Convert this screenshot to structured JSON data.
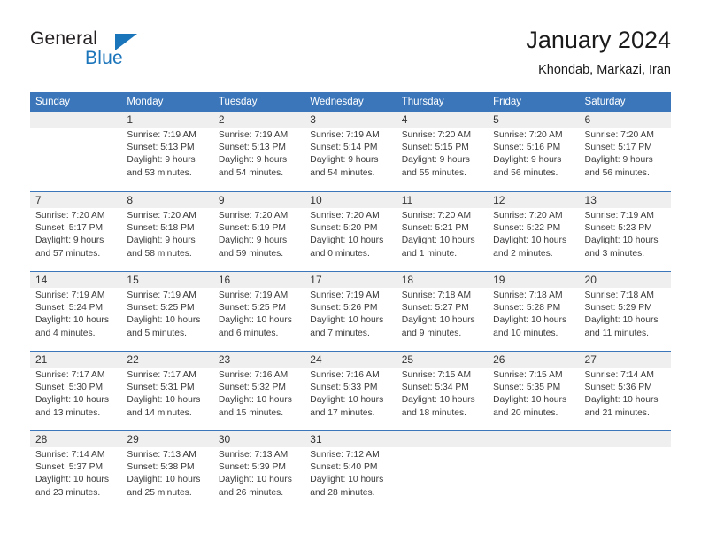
{
  "brand": {
    "name_part1": "General",
    "name_part2": "Blue",
    "accent_color": "#1b75bb",
    "triangle_icon": "triangle-icon"
  },
  "header": {
    "title": "January 2024",
    "subtitle": "Khondab, Markazi, Iran"
  },
  "calendar": {
    "header_bg": "#3b76ba",
    "daynum_band_bg": "#efefef",
    "weekday_headers": [
      "Sunday",
      "Monday",
      "Tuesday",
      "Wednesday",
      "Thursday",
      "Friday",
      "Saturday"
    ],
    "weeks": [
      [
        {
          "day": "",
          "info": ""
        },
        {
          "day": "1",
          "info": "Sunrise: 7:19 AM\nSunset: 5:13 PM\nDaylight: 9 hours\nand 53 minutes."
        },
        {
          "day": "2",
          "info": "Sunrise: 7:19 AM\nSunset: 5:13 PM\nDaylight: 9 hours\nand 54 minutes."
        },
        {
          "day": "3",
          "info": "Sunrise: 7:19 AM\nSunset: 5:14 PM\nDaylight: 9 hours\nand 54 minutes."
        },
        {
          "day": "4",
          "info": "Sunrise: 7:20 AM\nSunset: 5:15 PM\nDaylight: 9 hours\nand 55 minutes."
        },
        {
          "day": "5",
          "info": "Sunrise: 7:20 AM\nSunset: 5:16 PM\nDaylight: 9 hours\nand 56 minutes."
        },
        {
          "day": "6",
          "info": "Sunrise: 7:20 AM\nSunset: 5:17 PM\nDaylight: 9 hours\nand 56 minutes."
        }
      ],
      [
        {
          "day": "7",
          "info": "Sunrise: 7:20 AM\nSunset: 5:17 PM\nDaylight: 9 hours\nand 57 minutes."
        },
        {
          "day": "8",
          "info": "Sunrise: 7:20 AM\nSunset: 5:18 PM\nDaylight: 9 hours\nand 58 minutes."
        },
        {
          "day": "9",
          "info": "Sunrise: 7:20 AM\nSunset: 5:19 PM\nDaylight: 9 hours\nand 59 minutes."
        },
        {
          "day": "10",
          "info": "Sunrise: 7:20 AM\nSunset: 5:20 PM\nDaylight: 10 hours\nand 0 minutes."
        },
        {
          "day": "11",
          "info": "Sunrise: 7:20 AM\nSunset: 5:21 PM\nDaylight: 10 hours\nand 1 minute."
        },
        {
          "day": "12",
          "info": "Sunrise: 7:20 AM\nSunset: 5:22 PM\nDaylight: 10 hours\nand 2 minutes."
        },
        {
          "day": "13",
          "info": "Sunrise: 7:19 AM\nSunset: 5:23 PM\nDaylight: 10 hours\nand 3 minutes."
        }
      ],
      [
        {
          "day": "14",
          "info": "Sunrise: 7:19 AM\nSunset: 5:24 PM\nDaylight: 10 hours\nand 4 minutes."
        },
        {
          "day": "15",
          "info": "Sunrise: 7:19 AM\nSunset: 5:25 PM\nDaylight: 10 hours\nand 5 minutes."
        },
        {
          "day": "16",
          "info": "Sunrise: 7:19 AM\nSunset: 5:25 PM\nDaylight: 10 hours\nand 6 minutes."
        },
        {
          "day": "17",
          "info": "Sunrise: 7:19 AM\nSunset: 5:26 PM\nDaylight: 10 hours\nand 7 minutes."
        },
        {
          "day": "18",
          "info": "Sunrise: 7:18 AM\nSunset: 5:27 PM\nDaylight: 10 hours\nand 9 minutes."
        },
        {
          "day": "19",
          "info": "Sunrise: 7:18 AM\nSunset: 5:28 PM\nDaylight: 10 hours\nand 10 minutes."
        },
        {
          "day": "20",
          "info": "Sunrise: 7:18 AM\nSunset: 5:29 PM\nDaylight: 10 hours\nand 11 minutes."
        }
      ],
      [
        {
          "day": "21",
          "info": "Sunrise: 7:17 AM\nSunset: 5:30 PM\nDaylight: 10 hours\nand 13 minutes."
        },
        {
          "day": "22",
          "info": "Sunrise: 7:17 AM\nSunset: 5:31 PM\nDaylight: 10 hours\nand 14 minutes."
        },
        {
          "day": "23",
          "info": "Sunrise: 7:16 AM\nSunset: 5:32 PM\nDaylight: 10 hours\nand 15 minutes."
        },
        {
          "day": "24",
          "info": "Sunrise: 7:16 AM\nSunset: 5:33 PM\nDaylight: 10 hours\nand 17 minutes."
        },
        {
          "day": "25",
          "info": "Sunrise: 7:15 AM\nSunset: 5:34 PM\nDaylight: 10 hours\nand 18 minutes."
        },
        {
          "day": "26",
          "info": "Sunrise: 7:15 AM\nSunset: 5:35 PM\nDaylight: 10 hours\nand 20 minutes."
        },
        {
          "day": "27",
          "info": "Sunrise: 7:14 AM\nSunset: 5:36 PM\nDaylight: 10 hours\nand 21 minutes."
        }
      ],
      [
        {
          "day": "28",
          "info": "Sunrise: 7:14 AM\nSunset: 5:37 PM\nDaylight: 10 hours\nand 23 minutes."
        },
        {
          "day": "29",
          "info": "Sunrise: 7:13 AM\nSunset: 5:38 PM\nDaylight: 10 hours\nand 25 minutes."
        },
        {
          "day": "30",
          "info": "Sunrise: 7:13 AM\nSunset: 5:39 PM\nDaylight: 10 hours\nand 26 minutes."
        },
        {
          "day": "31",
          "info": "Sunrise: 7:12 AM\nSunset: 5:40 PM\nDaylight: 10 hours\nand 28 minutes."
        },
        {
          "day": "",
          "info": ""
        },
        {
          "day": "",
          "info": ""
        },
        {
          "day": "",
          "info": ""
        }
      ]
    ]
  }
}
